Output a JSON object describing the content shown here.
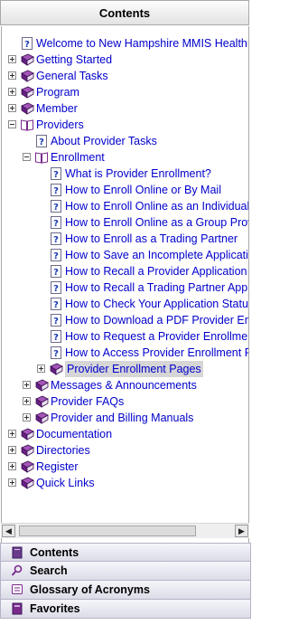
{
  "header": {
    "title": "Contents"
  },
  "tree": [
    {
      "label": "Welcome to New Hampshire MMIS Health Enterprise",
      "depth": 0,
      "icon": "help-page-icon",
      "expander": "none"
    },
    {
      "label": "Getting Started",
      "depth": 0,
      "icon": "closed-book-icon",
      "expander": "plus"
    },
    {
      "label": "General Tasks",
      "depth": 0,
      "icon": "closed-book-icon",
      "expander": "plus"
    },
    {
      "label": "Program",
      "depth": 0,
      "icon": "closed-book-icon",
      "expander": "plus"
    },
    {
      "label": "Member",
      "depth": 0,
      "icon": "closed-book-icon",
      "expander": "plus"
    },
    {
      "label": "Providers",
      "depth": 0,
      "icon": "open-book-icon",
      "expander": "minus"
    },
    {
      "label": "About Provider Tasks",
      "depth": 1,
      "icon": "help-page-icon",
      "expander": "none"
    },
    {
      "label": "Enrollment",
      "depth": 1,
      "icon": "open-book-icon",
      "expander": "minus"
    },
    {
      "label": "What is Provider Enrollment?",
      "depth": 2,
      "icon": "help-page-icon",
      "expander": "none"
    },
    {
      "label": "How to Enroll Online or By Mail",
      "depth": 2,
      "icon": "help-page-icon",
      "expander": "none"
    },
    {
      "label": "How to Enroll Online as an Individual Provider",
      "depth": 2,
      "icon": "help-page-icon",
      "expander": "none"
    },
    {
      "label": "How to Enroll Online as a Group Provider",
      "depth": 2,
      "icon": "help-page-icon",
      "expander": "none"
    },
    {
      "label": "How to Enroll as a Trading Partner",
      "depth": 2,
      "icon": "help-page-icon",
      "expander": "none"
    },
    {
      "label": "How to Save an Incomplete Application",
      "depth": 2,
      "icon": "help-page-icon",
      "expander": "none"
    },
    {
      "label": "How to Recall a Provider Application",
      "depth": 2,
      "icon": "help-page-icon",
      "expander": "none"
    },
    {
      "label": "How to Recall a Trading Partner Application",
      "depth": 2,
      "icon": "help-page-icon",
      "expander": "none"
    },
    {
      "label": "How to Check Your Application Status",
      "depth": 2,
      "icon": "help-page-icon",
      "expander": "none"
    },
    {
      "label": "How to Download a PDF Provider Enrollment",
      "depth": 2,
      "icon": "help-page-icon",
      "expander": "none"
    },
    {
      "label": "How to Request a Provider Enrollment Packet",
      "depth": 2,
      "icon": "help-page-icon",
      "expander": "none"
    },
    {
      "label": "How to Access Provider Enrollment FAQ",
      "depth": 2,
      "icon": "help-page-icon",
      "expander": "none"
    },
    {
      "label": "Provider Enrollment Pages",
      "depth": 2,
      "icon": "closed-book-icon",
      "expander": "plus",
      "selected": true
    },
    {
      "label": "Messages & Announcements",
      "depth": 1,
      "icon": "closed-book-icon",
      "expander": "plus"
    },
    {
      "label": "Provider FAQs",
      "depth": 1,
      "icon": "closed-book-icon",
      "expander": "plus"
    },
    {
      "label": "Provider and Billing Manuals",
      "depth": 1,
      "icon": "closed-book-icon",
      "expander": "plus"
    },
    {
      "label": "Documentation",
      "depth": 0,
      "icon": "closed-book-icon",
      "expander": "plus"
    },
    {
      "label": "Directories",
      "depth": 0,
      "icon": "closed-book-icon",
      "expander": "plus"
    },
    {
      "label": "Register",
      "depth": 0,
      "icon": "closed-book-icon",
      "expander": "plus"
    },
    {
      "label": "Quick Links",
      "depth": 0,
      "icon": "closed-book-icon",
      "expander": "plus"
    }
  ],
  "scrollbar": {
    "left_arrow": "◀",
    "right_arrow": "▶"
  },
  "bottom_tabs": [
    {
      "label": "Contents",
      "icon": "book-icon"
    },
    {
      "label": "Search",
      "icon": "magnifier-icon"
    },
    {
      "label": "Glossary of Acronyms",
      "icon": "glossary-icon"
    },
    {
      "label": "Favorites",
      "icon": "favorites-book-icon"
    }
  ],
  "colors": {
    "link": "#0000cc",
    "book": "#7a2a8c",
    "selected_bg": "#d6d6d6"
  }
}
